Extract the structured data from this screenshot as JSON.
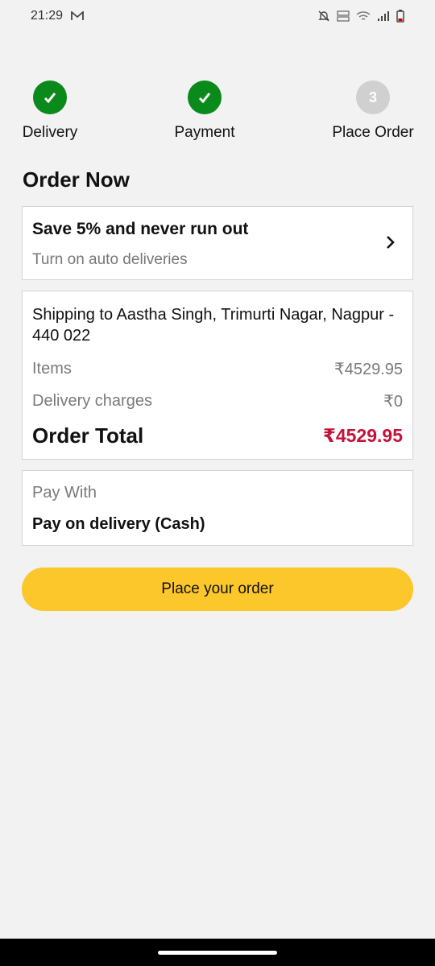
{
  "status_bar": {
    "time": "21:29",
    "left_icons": [
      "gmail-icon"
    ],
    "right_icons": [
      "mute-icon",
      "volte-icon",
      "wifi-icon",
      "signal-icon",
      "battery-icon"
    ]
  },
  "stepper": {
    "steps": [
      {
        "label": "Delivery",
        "state": "done",
        "icon": "check-icon"
      },
      {
        "label": "Payment",
        "state": "done",
        "icon": "check-icon"
      },
      {
        "label": "Place Order",
        "state": "pending",
        "number": "3"
      }
    ],
    "done_color": "#0a8a1a",
    "pending_color": "#d0d0d0"
  },
  "page_title": "Order Now",
  "auto_delivery": {
    "title": "Save 5% and never run out",
    "subtitle": "Turn on auto deliveries",
    "icon": "chevron-right-icon"
  },
  "summary": {
    "shipping": "Shipping to Aastha Singh, Trimurti Nagar, Nagpur - 440 022",
    "items_label": "Items",
    "items_value": "₹4529.95",
    "delivery_label": "Delivery charges",
    "delivery_value": "₹0",
    "total_label": "Order Total",
    "total_value": "₹4529.95",
    "total_color": "#c4123a"
  },
  "payment": {
    "label": "Pay With",
    "method": "Pay on delivery (Cash)"
  },
  "place_order_button": {
    "label": "Place your order",
    "color": "#fcc72b"
  }
}
